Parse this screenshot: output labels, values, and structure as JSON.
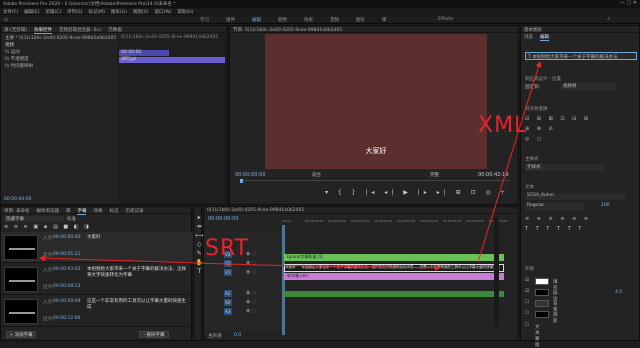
{
  "app": {
    "title": "Adobe Premiere Pro 2020 - E:\\Users\\c(\\文档\\Adobe\\Premiere Pro\\14.0\\未命名 *",
    "menu": [
      "文件(F)",
      "编辑(E)",
      "剪辑(C)",
      "序列(S)",
      "标记(M)",
      "图形(G)",
      "视图(V)",
      "窗口(W)",
      "帮助(H)"
    ],
    "workspaces": [
      "学习",
      "组件",
      "编辑",
      "颜色",
      "效果",
      "音频",
      "图形",
      "库"
    ],
    "workspace_active": "编辑",
    "extra_ws": "Effects"
  },
  "source_panel": {
    "tabs": [
      "源:(无剪辑)",
      "效果控件",
      "音频剪辑混合器: 0cc",
      "元数据"
    ],
    "active": "效果控件",
    "header": "主要 * 0(1)c1b0c-2e40-4205-9cee-998d1a0b2405",
    "clip_ref": "0(1)c1b0c-2e40-4205-9cee-998d1a0b2405",
    "rows": [
      "视频",
      "fx 运动",
      "fx 不透明度",
      "fx 时间重映射"
    ],
    "time_a": "00:00:00",
    "time_b": "SRT.jpt",
    "timecode": "00:00:00:00"
  },
  "program": {
    "title": "节目: 0(1)c1b0c-2e40-4205-9cee-998d1a0b2405",
    "caption": "大家好",
    "tc_left": "00:00:00:00",
    "fit": "适合",
    "full": "完整",
    "tc_right": "00:00:42:19"
  },
  "project_panel": {
    "tabs": [
      "项目: 未命名",
      "媒体浏览器",
      "库",
      "字幕",
      "效果",
      "标记",
      "历史记录"
    ],
    "active": "字幕",
    "fields": [
      "字幕流",
      "",
      "",
      "字幕",
      "12"
    ],
    "selector": "隐藏字幕",
    "standard": "标准",
    "captions": [
      {
        "in_label": "入点:",
        "in": "00:00:00:00",
        "out_label": "出点:",
        "out": "00:00:01:21",
        "text": "大家好"
      },
      {
        "in_label": "入点:",
        "in": "00:00:03:05",
        "out_label": "出点:",
        "out": "00:00:08:13",
        "text": "本视频给大家带来一个关于字幕的解决办法：怎样将文字快速转化为字幕"
      },
      {
        "in_label": "入点:",
        "in": "00:00:09:09",
        "out_label": "出点:",
        "out": "00:00:12:00",
        "text": "这是一个非常有用的工具可以让字幕大量的快速生成"
      }
    ],
    "btn_add": "+ 添加字幕",
    "btn_del": "- 删除字幕"
  },
  "timeline": {
    "title": "0(1)c1b0c-2e40-4205-9cee-998d1a0b2405",
    "timecode": "00:00:00:00",
    "ruler": [
      "00:00",
      "00:00:05:00",
      "00:00:10:00",
      "00:00:15:00",
      "00:00:20:00",
      "00:00:25:00",
      "00:00:30:00",
      "00:00:35:00",
      "00:00:40:00",
      "00:00:45:00"
    ],
    "tracks_v": [
      "V3",
      "V2",
      "V1"
    ],
    "tracks_a": [
      "A1",
      "A2",
      "A3"
    ],
    "master": "主声道",
    "master_val": "0.0",
    "caption_clip": "Lyrane字幕轨道 (1)",
    "seq_text": "大家好",
    "seq_line2": "本视频给大家带来一个关于字幕的解决办法：怎样将文字快速转化为字幕",
    "seq_line3": "这是一个非常有用的工具可以让字幕大量的快速生成",
    "pink_clip": "新字幕.xml"
  },
  "essential_graphics": {
    "tabs": [
      "浏览",
      "编辑"
    ],
    "active": "编辑",
    "layer": "本视频给大家带来一个关于字幕的解决办法",
    "responsive": "响应式设计 - 位置",
    "pin": "固定到:",
    "pin_val": "视频帧",
    "align": "对齐并变换",
    "master": "主样式",
    "master_val": "无样式",
    "text": "文本",
    "font": "SCSA_Kuhei",
    "style": "Regular",
    "size": "100",
    "appearance": "外观",
    "fill": "填充",
    "stroke": "描边",
    "shadow": "阴影",
    "bg": "背景",
    "mask": "文本蒙版",
    "fill_color": "#ffffff",
    "stroke_color": "#000000",
    "stroke_val": "4.0"
  },
  "annotations": {
    "xml": "XML",
    "srt": "SRT",
    "color": "#e8242a"
  }
}
